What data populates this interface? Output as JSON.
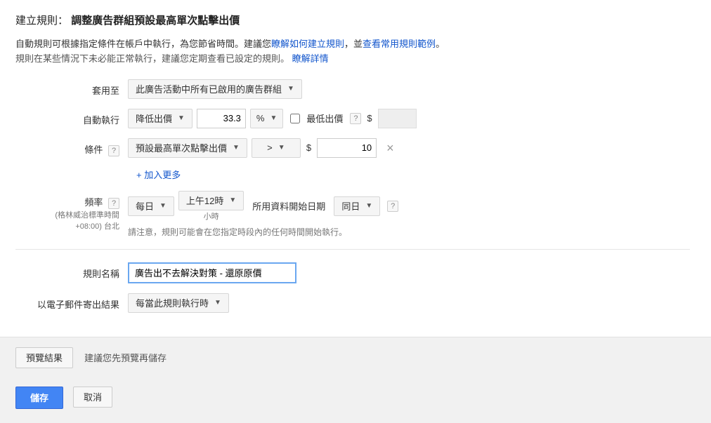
{
  "header": {
    "prefix": "建立規則：",
    "title": "調整廣告群組預設最高單次點擊出價"
  },
  "intro": {
    "line1a": "自動規則可根據指定條件在帳戶中執行，為您節省時間。建議您",
    "link1": "瞭解如何建立規則",
    "line1b": "，並",
    "link2": "查看常用規則範例",
    "line1c": "。",
    "line2a": "規則在某些情況下未必能正常執行，建議您定期查看已設定的規則。",
    "link3": "瞭解詳情"
  },
  "labels": {
    "apply_to": "套用至",
    "auto_action": "自動執行",
    "condition": "條件",
    "frequency": "頻率",
    "frequency_sub1": "(格林威治標準時間",
    "frequency_sub2": "+08:00) 台北",
    "rule_name": "規則名稱",
    "email_results": "以電子郵件寄出結果"
  },
  "apply_to": {
    "selected": "此廣告活動中所有已啟用的廣告群組"
  },
  "auto_action": {
    "action_selected": "降低出價",
    "value": "33.3",
    "unit_selected": "%",
    "min_bid_label": "最低出價",
    "currency": "$"
  },
  "condition": {
    "metric_selected": "預設最高單次點擊出價",
    "operator_selected": ">",
    "currency": "$",
    "value": "10"
  },
  "add_more": "+ 加入更多",
  "frequency": {
    "interval_selected": "每日",
    "time_selected": "上午12時",
    "hour_caption": "小時",
    "data_range_label": "所用資料開始日期",
    "range_selected": "同日",
    "note": "請注意，規則可能會在您指定時段內的任何時間開始執行。"
  },
  "rule_name_value": "廣告出不去解決對策 - 還原原價",
  "email": {
    "selected": "每當此規則執行時"
  },
  "footer": {
    "preview_btn": "預覽結果",
    "preview_hint": "建議您先預覽再儲存",
    "save": "儲存",
    "cancel": "取消"
  },
  "icons": {
    "help": "?",
    "caret": "▼",
    "remove": "×"
  }
}
